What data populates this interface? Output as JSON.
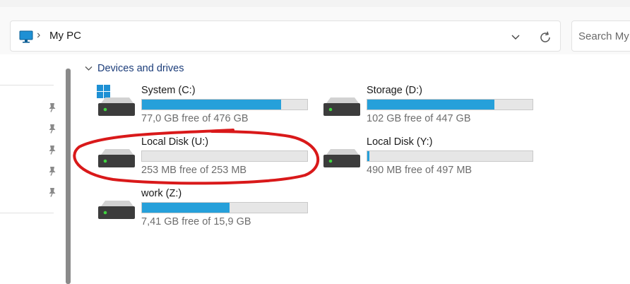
{
  "address": {
    "breadcrumb_separator": "›",
    "location": "My PC",
    "pc_icon": "monitor-icon",
    "dropdown_icon": "chevron-down-icon",
    "refresh_icon": "refresh-icon"
  },
  "search": {
    "placeholder": "Search My PC"
  },
  "sidebar": {
    "pin_icon": "pin-icon",
    "pinned_count": 5
  },
  "section": {
    "title": "Devices and drives",
    "collapse_icon": "chevron-down-icon"
  },
  "drives": [
    {
      "name": "System (C:)",
      "free_text": "77,0 GB free of 476 GB",
      "used_fraction": 0.84,
      "icon": "windows-drive-icon"
    },
    {
      "name": "Storage (D:)",
      "free_text": "102 GB free of 447 GB",
      "used_fraction": 0.77,
      "icon": "hard-drive-icon"
    },
    {
      "name": "Local Disk (U:)",
      "free_text": "253 MB free of 253 MB",
      "used_fraction": 0.0,
      "icon": "hard-drive-icon"
    },
    {
      "name": "Local Disk (Y:)",
      "free_text": "490 MB free of 497 MB",
      "used_fraction": 0.014,
      "icon": "hard-drive-icon"
    },
    {
      "name": "work (Z:)",
      "free_text": "7,41 GB free of 15,9 GB",
      "used_fraction": 0.53,
      "icon": "hard-drive-icon"
    }
  ],
  "colors": {
    "bar_fill": "#26a0da",
    "bar_track": "#e6e6e6",
    "annotation_circle": "#d9191a",
    "section_title": "#1c3d7a"
  }
}
